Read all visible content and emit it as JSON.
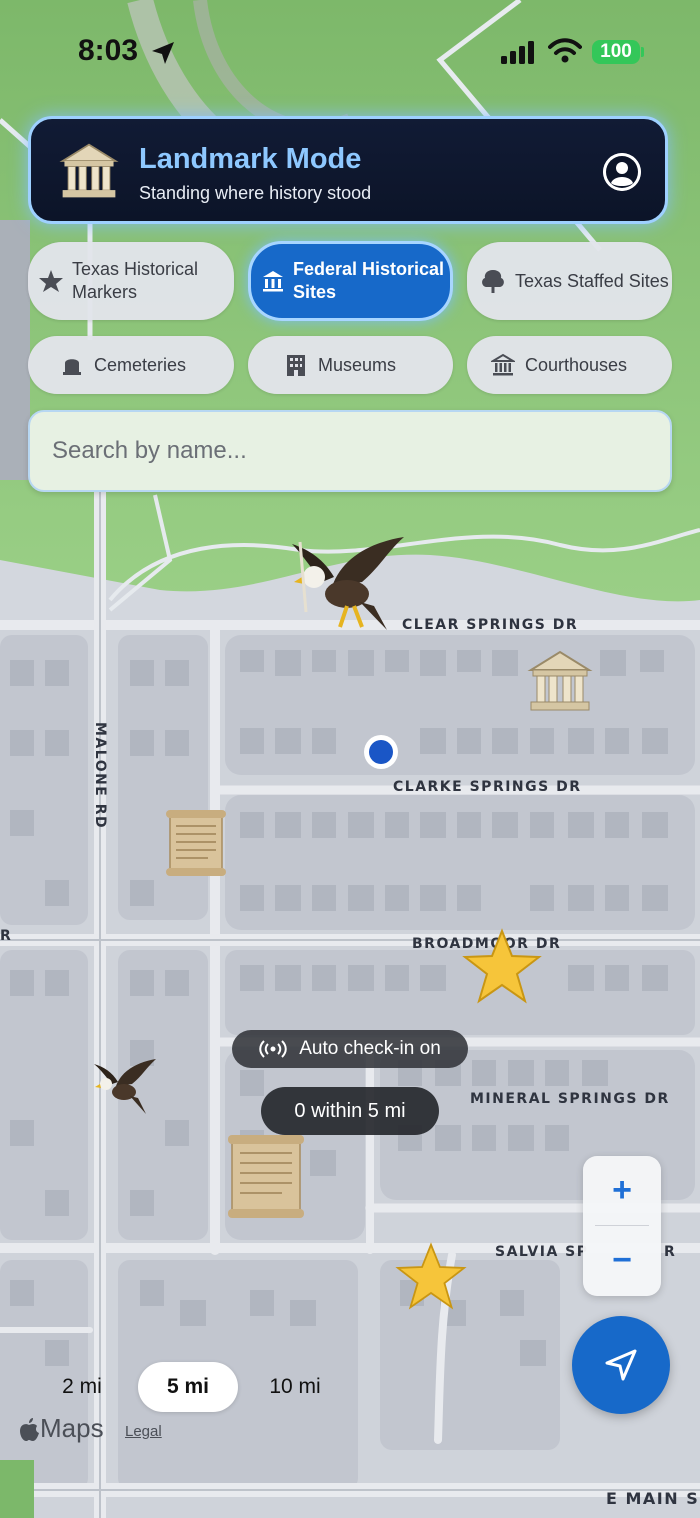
{
  "status_bar": {
    "time": "8:03",
    "battery": "100"
  },
  "header": {
    "title": "Landmark Mode",
    "subtitle": "Standing where history stood",
    "logo_icon": "columned-building-icon",
    "profile_icon": "person-circle-icon",
    "accent_color": "#8ec8ff",
    "background_color": "#0c1428"
  },
  "filters": [
    {
      "label": "Texas Historical Markers",
      "icon": "star-icon",
      "active": false
    },
    {
      "label": "Federal Historical Sites",
      "icon": "bank-icon",
      "active": true
    },
    {
      "label": "Texas Staffed Sites",
      "icon": "tree-icon",
      "active": false
    },
    {
      "label": "Cemeteries",
      "icon": "tombstone-icon",
      "active": false
    },
    {
      "label": "Museums",
      "icon": "building-icon",
      "active": false
    },
    {
      "label": "Courthouses",
      "icon": "courthouse-icon",
      "active": false
    }
  ],
  "search": {
    "placeholder": "Search by name...",
    "value": ""
  },
  "map": {
    "road_labels": {
      "clear_springs": "CLEAR SPRINGS DR",
      "clarke_springs": "CLARKE SPRINGS DR",
      "broadmoor": "BROADMOOR DR",
      "mineral_springs": "MINERAL SPRINGS DR",
      "salvia": "SALVIA SP",
      "salvia_suffix": "R",
      "malone": "MALONE RD",
      "main": "E MAIN S",
      "left_edge": "R"
    },
    "markers": [
      "eagle-icon",
      "courthouse-icon",
      "user-location-icon",
      "scroll-icon",
      "star-icon",
      "eagle-icon",
      "scroll-icon",
      "star-icon"
    ],
    "colors": {
      "park": "#8fc77a",
      "block": "#c9ccd4",
      "road": "#e9ebef",
      "user_dot": "#1a56c6"
    }
  },
  "pills": {
    "auto_checkin": "Auto check-in on",
    "count": "0 within 5 mi"
  },
  "zoom": {
    "in_label": "+",
    "out_label": "−"
  },
  "radius": {
    "options": [
      "2 mi",
      "5 mi",
      "10 mi"
    ],
    "selected": "5 mi"
  },
  "attribution": {
    "maps": "Maps",
    "legal": "Legal"
  },
  "accent_blue": "#1769c9"
}
